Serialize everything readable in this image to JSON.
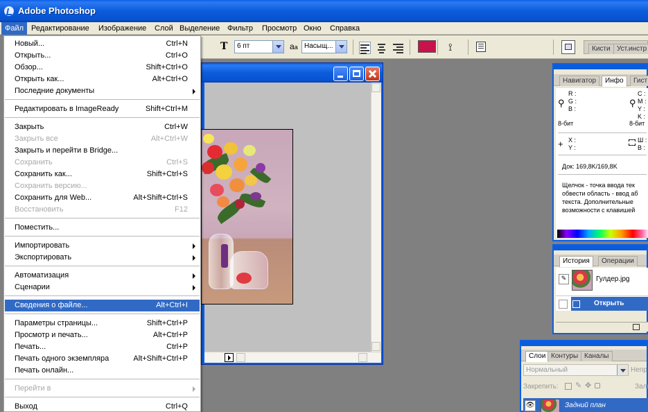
{
  "app": {
    "title": "Adobe Photoshop"
  },
  "menubar": {
    "items": [
      "Файл",
      "Редактирование",
      "Изображение",
      "Слой",
      "Выделение",
      "Фильтр",
      "Просмотр",
      "Окно",
      "Справка"
    ]
  },
  "file_menu": {
    "items": [
      {
        "label": "Новый...",
        "shortcut": "Ctrl+N",
        "enabled": true
      },
      {
        "label": "Открыть...",
        "shortcut": "Ctrl+O",
        "enabled": true
      },
      {
        "label": "Обзор...",
        "shortcut": "Shift+Ctrl+O",
        "enabled": true
      },
      {
        "label": "Открыть как...",
        "shortcut": "Alt+Ctrl+O",
        "enabled": true
      },
      {
        "label": "Последние документы",
        "shortcut": "",
        "enabled": true,
        "submenu": true
      },
      {
        "label": "Редактировать в ImageReady",
        "shortcut": "Shift+Ctrl+M",
        "enabled": true
      },
      {
        "label": "Закрыть",
        "shortcut": "Ctrl+W",
        "enabled": true
      },
      {
        "label": "Закрыть все",
        "shortcut": "Alt+Ctrl+W",
        "enabled": false
      },
      {
        "label": "Закрыть и перейти в Bridge...",
        "shortcut": "",
        "enabled": true
      },
      {
        "label": "Сохранить",
        "shortcut": "Ctrl+S",
        "enabled": false
      },
      {
        "label": "Сохранить как...",
        "shortcut": "Shift+Ctrl+S",
        "enabled": true
      },
      {
        "label": "Сохранить версию...",
        "shortcut": "",
        "enabled": false
      },
      {
        "label": "Сохранить для Web...",
        "shortcut": "Alt+Shift+Ctrl+S",
        "enabled": true
      },
      {
        "label": "Восстановить",
        "shortcut": "F12",
        "enabled": false
      },
      {
        "label": "Поместить...",
        "shortcut": "",
        "enabled": true
      },
      {
        "label": "Импортировать",
        "shortcut": "",
        "enabled": true,
        "submenu": true
      },
      {
        "label": "Экспортировать",
        "shortcut": "",
        "enabled": true,
        "submenu": true
      },
      {
        "label": "Автоматизация",
        "shortcut": "",
        "enabled": true,
        "submenu": true
      },
      {
        "label": "Сценарии",
        "shortcut": "",
        "enabled": true,
        "submenu": true
      },
      {
        "label": "Сведения о файле...",
        "shortcut": "Alt+Ctrl+I",
        "enabled": true,
        "highlighted": true
      },
      {
        "label": "Параметры страницы...",
        "shortcut": "Shift+Ctrl+P",
        "enabled": true
      },
      {
        "label": "Просмотр и печать...",
        "shortcut": "Alt+Ctrl+P",
        "enabled": true
      },
      {
        "label": "Печать...",
        "shortcut": "Ctrl+P",
        "enabled": true
      },
      {
        "label": "Печать одного экземпляра",
        "shortcut": "Alt+Shift+Ctrl+P",
        "enabled": true
      },
      {
        "label": "Печать онлайн...",
        "shortcut": "",
        "enabled": true
      },
      {
        "label": "Перейти в",
        "shortcut": "",
        "enabled": false,
        "submenu": true
      },
      {
        "label": "Выход",
        "shortcut": "Ctrl+Q",
        "enabled": true
      }
    ]
  },
  "options": {
    "font_size": "6 пт",
    "aa_symbol": "a",
    "aa_sub": "a",
    "antialias": "Насыщ...",
    "text_color": "#c8124c",
    "brushes_tab": "Кисти",
    "tools_tab": "Уст.инстр"
  },
  "nav_panel": {
    "tabs": [
      "Навигатор",
      "Инфо",
      "Гист"
    ],
    "rgb": [
      "R :",
      "G :",
      "B :"
    ],
    "cmyk": [
      "C :",
      "M :",
      "Y :",
      "K :"
    ],
    "depth_left": "8-бит",
    "depth_right": "8-бит",
    "xy": [
      "X :",
      "Y :"
    ],
    "wh": [
      "Ш :",
      "В :"
    ],
    "doc_info": "Док: 169,8K/169,8K",
    "hint": [
      "Щелчок - точка ввода тек",
      "обвести область - ввод аб",
      "текста. Дополнительные",
      "возможности с клавишей"
    ]
  },
  "history_panel": {
    "tabs": [
      "История",
      "Операции"
    ],
    "snapshot": "Гулдер.jpg",
    "step": "Открыть"
  },
  "layers_panel": {
    "tabs": [
      "Слои",
      "Контуры",
      "Каналы"
    ],
    "blend_mode": "Нормальный",
    "opacity_label": "Непр",
    "lock_label": "Закрепить:",
    "fill_label": "Зали",
    "layer_name": "Задний план"
  }
}
